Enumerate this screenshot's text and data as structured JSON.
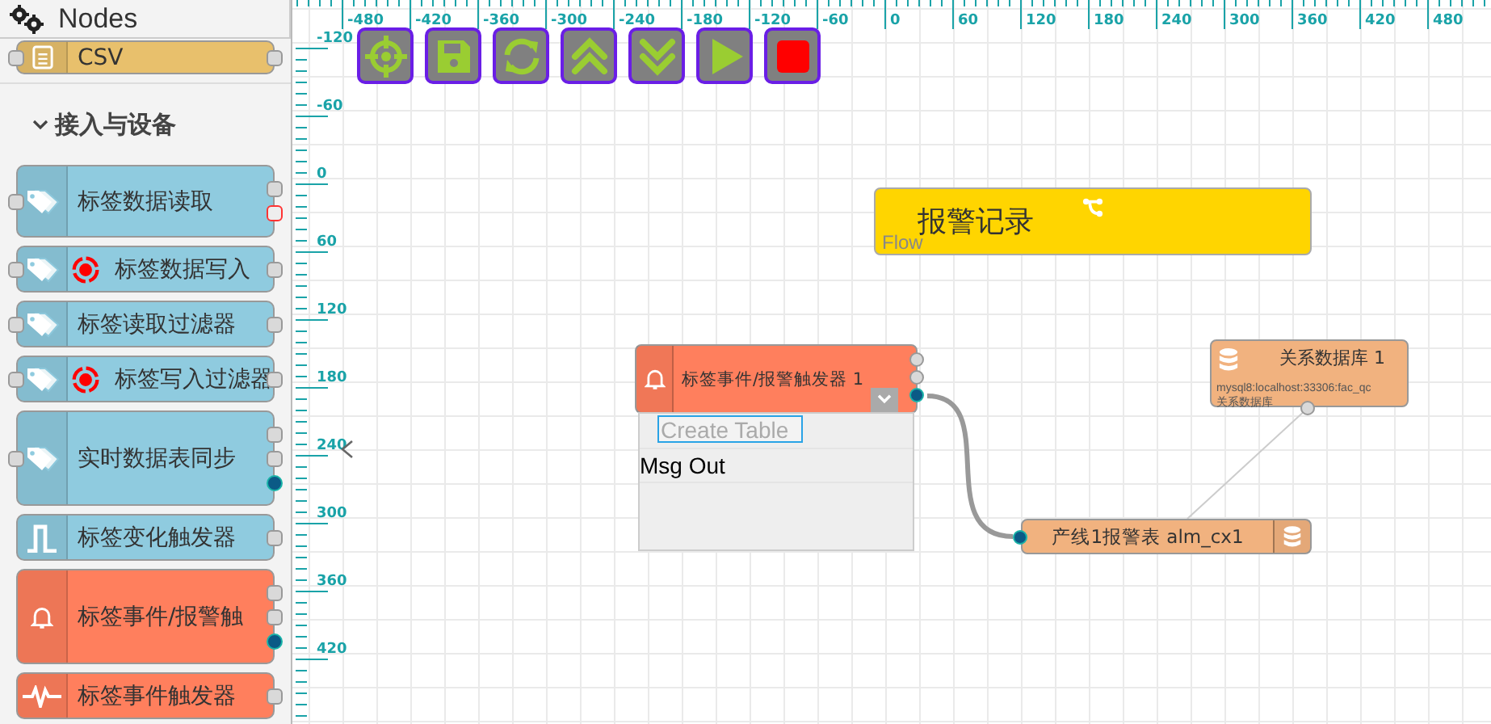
{
  "sidebar": {
    "title": "Nodes",
    "items": [
      {
        "kind": "file",
        "label": "CSV",
        "color": "#e8c06c",
        "input": true,
        "outputs": [
          {
            "kind": "plain"
          }
        ]
      },
      {
        "kind": "category",
        "label": "接入与设备",
        "expanded": true
      },
      {
        "kind": "tag",
        "label": "标签数据读取",
        "color": "#8fcbdf",
        "input": true,
        "outputs": [
          {
            "kind": "plain"
          },
          {
            "kind": "error"
          }
        ]
      },
      {
        "kind": "tag-target",
        "label": "标签数据写入",
        "color": "#8fcbdf",
        "input": true,
        "outputs": [
          {
            "kind": "plain"
          }
        ]
      },
      {
        "kind": "tag",
        "label": "标签读取过滤器",
        "color": "#8fcbdf",
        "input": true,
        "outputs": [
          {
            "kind": "plain"
          }
        ]
      },
      {
        "kind": "tag-target",
        "label": "标签写入过滤器",
        "color": "#8fcbdf",
        "input": true,
        "outputs": [
          {
            "kind": "plain"
          }
        ]
      },
      {
        "kind": "tag",
        "label": "实时数据表同步",
        "color": "#8fcbdf",
        "input": true,
        "outputs": [
          {
            "kind": "plain"
          },
          {
            "kind": "plain"
          },
          {
            "kind": "link"
          }
        ]
      },
      {
        "kind": "pulse",
        "label": "标签变化触发器",
        "color": "#8fcbdf",
        "input": false,
        "outputs": [
          {
            "kind": "plain"
          }
        ]
      },
      {
        "kind": "bell",
        "label": "标签事件/报警触",
        "color": "#ff7f5d",
        "input": false,
        "outputs": [
          {
            "kind": "plain"
          },
          {
            "kind": "plain"
          },
          {
            "kind": "link"
          }
        ]
      },
      {
        "kind": "wave",
        "label": "标签事件触发器",
        "color": "#ff7f5d",
        "input": false,
        "outputs": [
          {
            "kind": "plain"
          }
        ]
      }
    ]
  },
  "ruler": {
    "x_labels": [
      "-480",
      "-420",
      "-360",
      "-300",
      "-240",
      "-180",
      "-120",
      "-60",
      "0",
      "60",
      "120",
      "180",
      "240",
      "300",
      "360",
      "420",
      "480"
    ],
    "y_labels": [
      "-120",
      "-60",
      "0",
      "60",
      "120",
      "180",
      "240",
      "300",
      "360",
      "420"
    ]
  },
  "toolbar": [
    {
      "kind": "locate"
    },
    {
      "kind": "save"
    },
    {
      "kind": "refresh"
    },
    {
      "kind": "collapse"
    },
    {
      "kind": "expand"
    },
    {
      "kind": "run"
    },
    {
      "kind": "stop"
    }
  ],
  "nodes": [
    {
      "kind": "flow",
      "label": "报警记录",
      "sublabel": "Flow"
    },
    {
      "kind": "trigger",
      "label": "标签事件/报警触发器 1",
      "outputs": [
        {
          "kind": "plain"
        },
        {
          "kind": "plain"
        },
        {
          "kind": "link"
        }
      ],
      "panel": {
        "field": {
          "placeholder": "Create Table"
        },
        "rows": [
          "Msg Out"
        ]
      }
    },
    {
      "kind": "database",
      "label": "关系数据库 1",
      "details": [
        "mysql8:localhost:33306:fac_qc",
        "关系数据库"
      ]
    },
    {
      "kind": "table",
      "label": "产线1报警表 alm_cx1"
    }
  ],
  "wires": [
    {
      "kind": "flow"
    },
    {
      "kind": "config"
    }
  ]
}
